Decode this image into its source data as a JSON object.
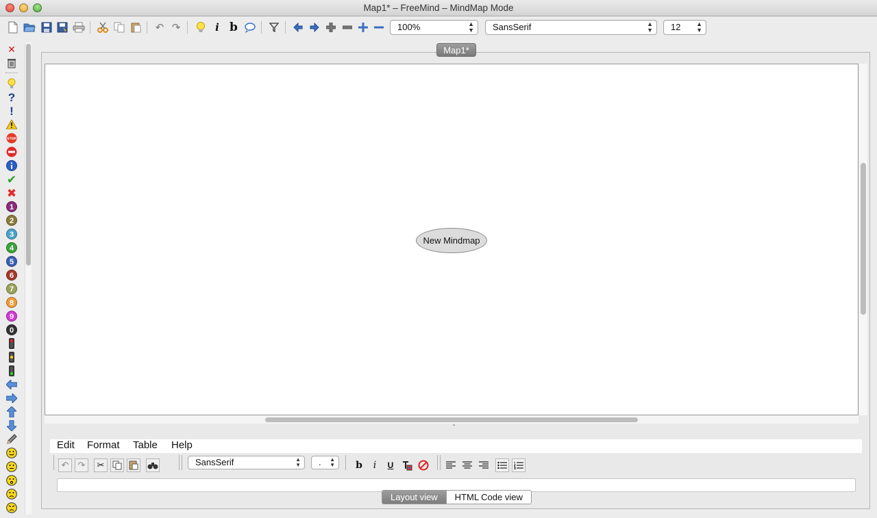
{
  "window": {
    "title": "Map1* – FreeMind – MindMap Mode"
  },
  "toolbar": {
    "zoom": "100%",
    "font_family": "SansSerif",
    "font_size": "12",
    "icons": {
      "bold_label": "b",
      "italic_label": "i"
    }
  },
  "map_tab": {
    "label": "Map1*"
  },
  "map": {
    "root_node": "New Mindmap"
  },
  "side_icons": {
    "remove_last": "✕",
    "question": "?",
    "exclamation": "!",
    "stop_label": "STOP",
    "numbers": [
      "1",
      "2",
      "3",
      "4",
      "5",
      "6",
      "7",
      "8",
      "9",
      "0"
    ]
  },
  "note_editor": {
    "menu": [
      "Edit",
      "Format",
      "Table",
      "Help"
    ],
    "font_family": "SansSerif",
    "font_size": ".",
    "bold_label": "b",
    "italic_label": "i",
    "underline_label": "U",
    "views": {
      "layout": "Layout view",
      "html": "HTML Code view"
    }
  },
  "colors": {
    "accent_tab": "#8a8a8a",
    "node_fill": "#dcdcdc",
    "canvas": "#ffffff"
  }
}
